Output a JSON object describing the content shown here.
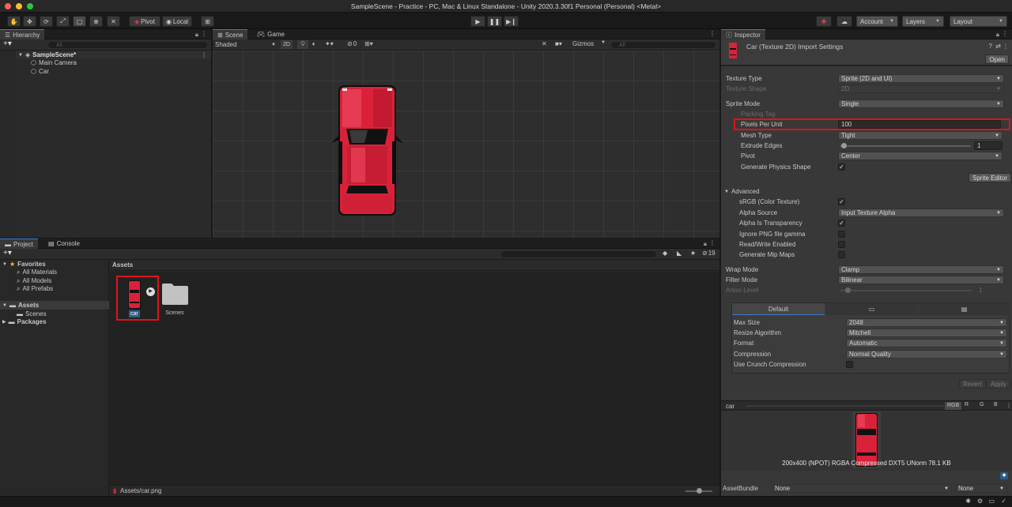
{
  "window": {
    "title": "SampleScene - Practice - PC, Mac & Linux Standalone - Unity 2020.3.30f1 Personal (Personal) <Metal>"
  },
  "toolbar": {
    "pivot": "Pivot",
    "local": "Local",
    "account": "Account",
    "layers": "Layers",
    "layout": "Layout"
  },
  "hierarchy": {
    "tab": "Hierarchy",
    "search_placeholder": "All",
    "scene": "SampleScene*",
    "items": [
      "Main Camera",
      "Car"
    ]
  },
  "scene_view": {
    "tabs": [
      "Scene",
      "Game"
    ],
    "shading": "Shaded",
    "mode_2d": "2D",
    "hidden_count": "0",
    "gizmos": "Gizmos",
    "search_placeholder": "All"
  },
  "project": {
    "tabs": [
      "Project",
      "Console"
    ],
    "favorites_label": "Favorites",
    "favorites": [
      "All Materials",
      "All Models",
      "All Prefabs"
    ],
    "assets_label": "Assets",
    "asset_folders": [
      "Scenes"
    ],
    "packages_label": "Packages",
    "breadcrumb": "Assets",
    "visible_count": "19",
    "files": [
      {
        "name": "car",
        "type": "sprite"
      },
      {
        "name": "Scenes",
        "type": "folder"
      }
    ],
    "footer_path": "Assets/car.png"
  },
  "inspector": {
    "tab": "Inspector",
    "title": "Car (Texture 2D) Import Settings",
    "open_button": "Open",
    "rows": {
      "texture_type": {
        "label": "Texture Type",
        "value": "Sprite (2D and UI)"
      },
      "texture_shape": {
        "label": "Texture Shape",
        "value": "2D"
      },
      "sprite_mode": {
        "label": "Sprite Mode",
        "value": "Single"
      },
      "packing_tag": {
        "label": "Packing Tag",
        "value": ""
      },
      "pixels_per_unit": {
        "label": "Pixels Per Unit",
        "value": "100"
      },
      "mesh_type": {
        "label": "Mesh Type",
        "value": "Tight"
      },
      "extrude_edges": {
        "label": "Extrude Edges",
        "value": "1"
      },
      "pivot": {
        "label": "Pivot",
        "value": "Center"
      },
      "generate_physics": {
        "label": "Generate Physics Shape",
        "checked": true
      }
    },
    "sprite_editor_button": "Sprite Editor",
    "advanced": {
      "label": "Advanced",
      "srgb": {
        "label": "sRGB (Color Texture)",
        "checked": true
      },
      "alpha_source": {
        "label": "Alpha Source",
        "value": "Input Texture Alpha"
      },
      "alpha_transparency": {
        "label": "Alpha Is Transparency",
        "checked": true
      },
      "ignore_png_gamma": {
        "label": "Ignore PNG file gamma",
        "checked": false
      },
      "read_write": {
        "label": "Read/Write Enabled",
        "checked": false
      },
      "mip_maps": {
        "label": "Generate Mip Maps",
        "checked": false
      }
    },
    "wrap_mode": {
      "label": "Wrap Mode",
      "value": "Clamp"
    },
    "filter_mode": {
      "label": "Filter Mode",
      "value": "Bilinear"
    },
    "aniso_level": {
      "label": "Aniso Level",
      "value": "1"
    },
    "platform_tab": "Default",
    "platform": {
      "max_size": {
        "label": "Max Size",
        "value": "2048"
      },
      "resize": {
        "label": "Resize Algorithm",
        "value": "Mitchell"
      },
      "format": {
        "label": "Format",
        "value": "Automatic"
      },
      "compression": {
        "label": "Compression",
        "value": "Normal Quality"
      },
      "crunch": {
        "label": "Use Crunch Compression",
        "checked": false
      }
    },
    "revert_button": "Revert",
    "apply_button": "Apply",
    "preview": {
      "name": "car",
      "channels": [
        "RGB",
        "R",
        "G",
        "B"
      ],
      "info": "200x400 (NPOT)  RGBA Compressed DXT5 UNorm  78.1 KB"
    },
    "asset_bundle": {
      "label": "AssetBundle",
      "value": "None",
      "variant": "None"
    }
  },
  "colors": {
    "accent": "#3c7bd0",
    "highlight_border": "#e0131b",
    "car_red": "#d9223a"
  }
}
